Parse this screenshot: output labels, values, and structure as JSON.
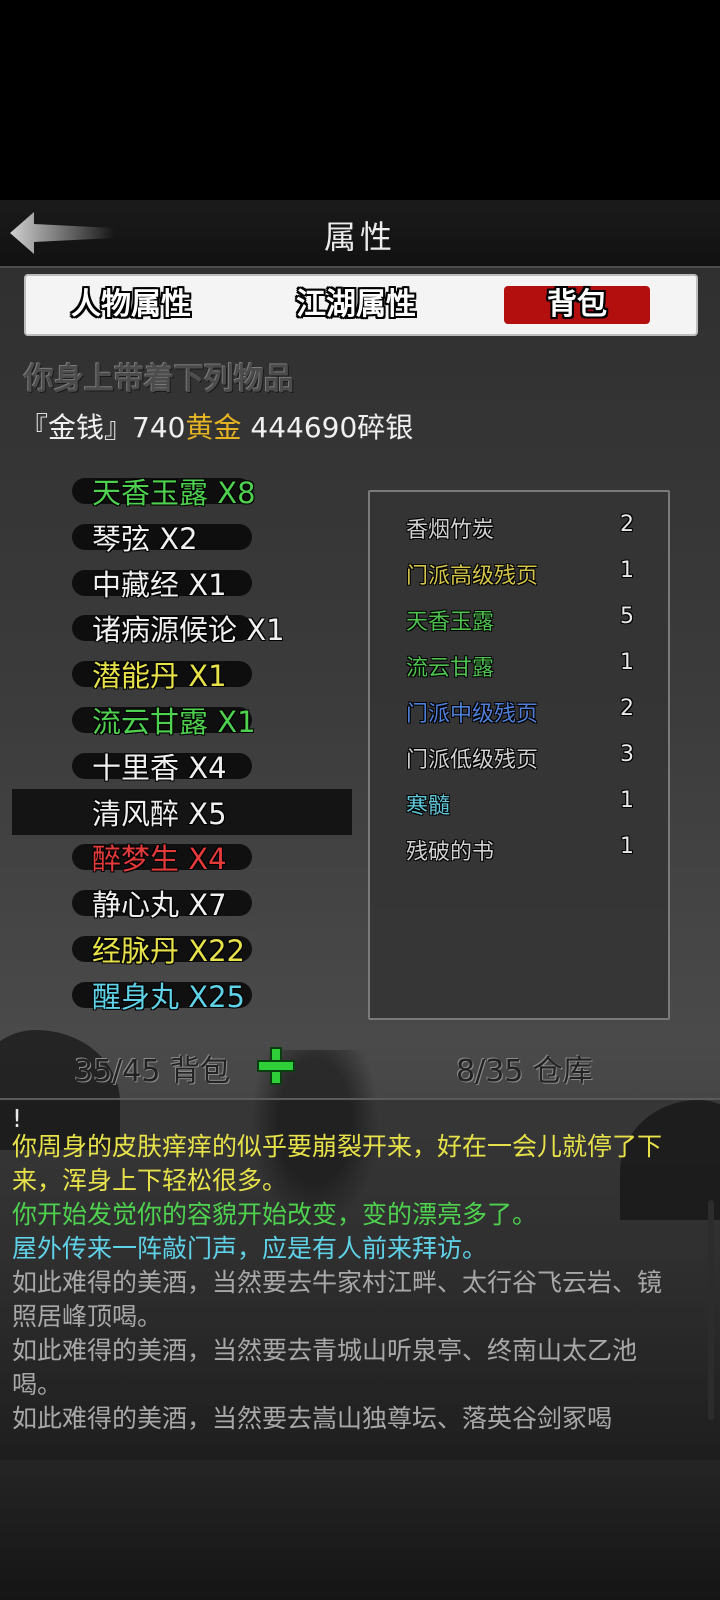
{
  "header": {
    "title": "属性",
    "back": "back-arrow-icon"
  },
  "tabs": [
    {
      "label": "人物属性",
      "active": false
    },
    {
      "label": "江湖属性",
      "active": false
    },
    {
      "label": "背包",
      "active": true
    }
  ],
  "bag": {
    "heading": "你身上带着下列物品",
    "money_label": "『金钱』",
    "gold_amount": "740",
    "gold_unit": "黄金",
    "silver_amount": "444690",
    "silver_unit": "碎银",
    "items": [
      {
        "name": "天香玉露",
        "qty": "X8",
        "color": "#4ed14e"
      },
      {
        "name": "琴弦",
        "qty": "X2",
        "color": "#f0f0f0"
      },
      {
        "name": "中藏经",
        "qty": "X1",
        "color": "#f0f0f0"
      },
      {
        "name": "诸病源候论",
        "qty": "X1",
        "color": "#f0f0f0"
      },
      {
        "name": "潜能丹",
        "qty": "X1",
        "color": "#e8e24a"
      },
      {
        "name": "流云甘露",
        "qty": "X1",
        "color": "#4ed14e"
      },
      {
        "name": "十里香",
        "qty": "X4",
        "color": "#f0f0f0"
      },
      {
        "name": "清风醉",
        "qty": "X5",
        "color": "#f0f0f0",
        "selected": true
      },
      {
        "name": "醉梦生",
        "qty": "X4",
        "color": "#e53a3a"
      },
      {
        "name": "静心丸",
        "qty": "X7",
        "color": "#f0f0f0"
      },
      {
        "name": "经脉丹",
        "qty": "X22",
        "color": "#e8e24a"
      },
      {
        "name": "醒身丸",
        "qty": "X25",
        "color": "#5fd2e8"
      }
    ],
    "capacity": "35/45 背包",
    "warehouse": "8/35 仓库"
  },
  "storage": [
    {
      "name": "香烟竹炭",
      "count": "2",
      "color": "#d0d0d0"
    },
    {
      "name": "门派高级残页",
      "count": "1",
      "color": "#d4c44a"
    },
    {
      "name": "天香玉露",
      "count": "5",
      "color": "#4ec24e"
    },
    {
      "name": "流云甘露",
      "count": "1",
      "color": "#4ec24e"
    },
    {
      "name": "门派中级残页",
      "count": "2",
      "color": "#4f7fd8"
    },
    {
      "name": "门派低级残页",
      "count": "3",
      "color": "#d0d0d0"
    },
    {
      "name": "寒髓",
      "count": "1",
      "color": "#5fc6d8"
    },
    {
      "name": "残破的书",
      "count": "1",
      "color": "#d0d0d0"
    }
  ],
  "log": [
    {
      "text": "!",
      "color": "#e8e8e8"
    },
    {
      "text": "你周身的皮肤痒痒的似乎要崩裂开来，好在一会儿就停了下来，浑身上下轻松很多。",
      "color": "#e8e24a"
    },
    {
      "text": "你开始发觉你的容貌开始改变，变的漂亮多了。",
      "color": "#4ed14e"
    },
    {
      "text": "屋外传来一阵敲门声，应是有人前来拜访。",
      "color": "#5fd2e8"
    },
    {
      "text": "如此难得的美酒，当然要去牛家村江畔、太行谷飞云岩、镜照居峰顶喝。",
      "color": "#a8a8a8"
    },
    {
      "text": "如此难得的美酒，当然要去青城山听泉亭、终南山太乙池喝。",
      "color": "#a8a8a8"
    },
    {
      "text": "如此难得的美酒，当然要去嵩山独尊坛、落英谷剑冢喝",
      "color": "#a8a8a8"
    }
  ],
  "colors": {
    "accent": "#b30f0f",
    "gold": "#e6b422",
    "plus": "#2fcf3a"
  }
}
